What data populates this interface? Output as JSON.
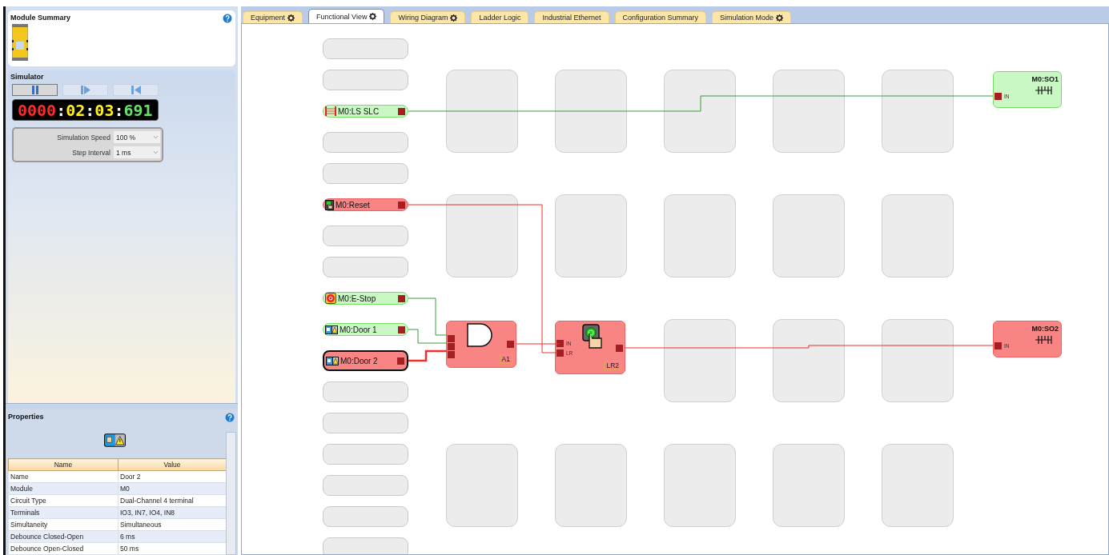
{
  "module_summary": {
    "title": "Module Summary"
  },
  "simulator": {
    "title": "Simulator",
    "controls": [
      {
        "kind": "pause",
        "selected": true
      },
      {
        "kind": "step",
        "selected": false
      },
      {
        "kind": "restart",
        "selected": false
      }
    ],
    "timer": [
      {
        "kind": "hours",
        "text": "0000"
      },
      {
        "kind": "separator",
        "text": ":"
      },
      {
        "kind": "minutes",
        "text": "02"
      },
      {
        "kind": "separator",
        "text": ":"
      },
      {
        "kind": "seconds",
        "text": "03"
      },
      {
        "kind": "separator",
        "text": ":"
      },
      {
        "kind": "milliseconds",
        "text": "691"
      }
    ],
    "settings": [
      {
        "label": "Simulation Speed",
        "value": "100 %"
      },
      {
        "label": "Step Interval",
        "value": "1 ms"
      }
    ]
  },
  "properties": {
    "title": "Properties",
    "columns": [
      "Name",
      "Value"
    ],
    "rows": [
      [
        "Name",
        "Door 2"
      ],
      [
        "Module",
        "M0"
      ],
      [
        "Circuit Type",
        "Dual-Channel 4 terminal"
      ],
      [
        "Terminals",
        "IO3, IN7, IO4, IN8"
      ],
      [
        "Simultaneity",
        "Simultaneous"
      ],
      [
        "Debounce Closed-Open",
        "6 ms"
      ],
      [
        "Debounce Open-Closed",
        "50 ms"
      ]
    ]
  },
  "tabs": [
    {
      "label": "Equipment",
      "gear": true,
      "selected": false
    },
    {
      "label": "Functional View",
      "gear": true,
      "selected": true
    },
    {
      "label": "Wiring Diagram",
      "gear": true,
      "selected": false
    },
    {
      "label": "Ladder Logic",
      "gear": false,
      "selected": false
    },
    {
      "label": "Industrial Ethernet",
      "gear": false,
      "selected": false
    },
    {
      "label": "Configuration Summary",
      "gear": false,
      "selected": false
    },
    {
      "label": "Simulation Mode",
      "gear": true,
      "selected": false
    }
  ],
  "inputs": [
    {
      "kind": "empty"
    },
    {
      "kind": "empty"
    },
    {
      "kind": "light_curtain",
      "label": "M0:LS SLC",
      "energized": true,
      "selected": false
    },
    {
      "kind": "empty"
    },
    {
      "kind": "empty"
    },
    {
      "kind": "reset",
      "label": "M0:Reset",
      "energized": false,
      "selected": false
    },
    {
      "kind": "empty"
    },
    {
      "kind": "empty"
    },
    {
      "kind": "estop",
      "label": "M0:E-Stop",
      "energized": true,
      "selected": false
    },
    {
      "kind": "door",
      "label": "M0:Door 1",
      "energized": true,
      "selected": false
    },
    {
      "kind": "door",
      "label": "M0:Door 2",
      "energized": false,
      "selected": true
    },
    {
      "kind": "empty"
    },
    {
      "kind": "empty"
    },
    {
      "kind": "empty"
    },
    {
      "kind": "empty"
    },
    {
      "kind": "empty"
    },
    {
      "kind": "empty"
    }
  ],
  "function_grid": [
    [
      {
        "kind": "empty"
      },
      {
        "kind": "empty"
      },
      {
        "kind": "empty"
      },
      {
        "kind": "empty"
      },
      {
        "kind": "empty"
      }
    ],
    [
      {
        "kind": "empty"
      },
      {
        "kind": "empty"
      },
      {
        "kind": "empty"
      },
      {
        "kind": "empty"
      },
      {
        "kind": "empty"
      }
    ],
    [
      {
        "kind": "and_gate",
        "label": "A1",
        "energized": false
      },
      {
        "kind": "latch_reset",
        "label": "LR2",
        "ports": [
          "IN",
          "LR"
        ],
        "energized": false
      },
      {
        "kind": "empty"
      },
      {
        "kind": "empty"
      },
      {
        "kind": "empty"
      }
    ],
    [
      {
        "kind": "empty"
      },
      {
        "kind": "empty"
      },
      {
        "kind": "empty"
      },
      {
        "kind": "empty"
      },
      {
        "kind": "empty"
      }
    ]
  ],
  "outputs": [
    {
      "kind": "output",
      "label": "M0:SO1",
      "port": "IN",
      "energized": true
    },
    {
      "kind": "blank"
    },
    {
      "kind": "output",
      "label": "M0:SO2",
      "port": "IN",
      "energized": false
    },
    {
      "kind": "blank"
    }
  ]
}
